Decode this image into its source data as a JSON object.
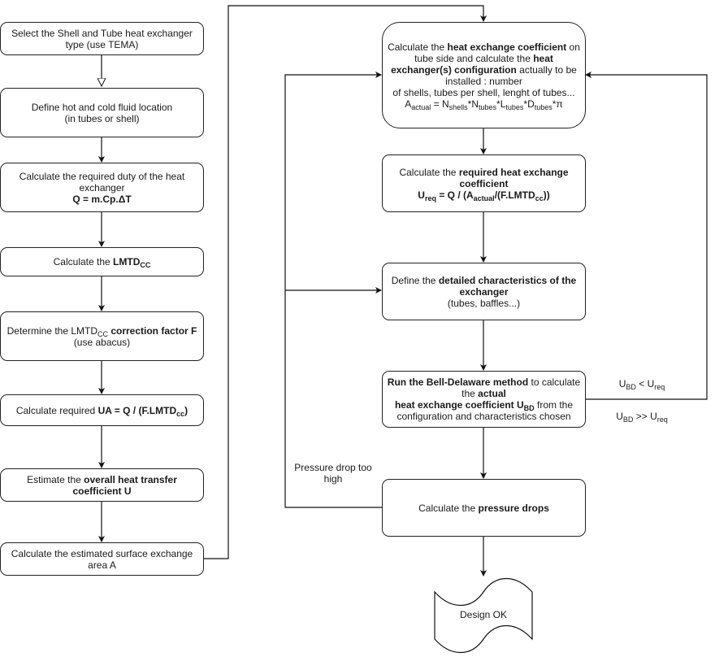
{
  "left_column": [
    {
      "id": "step-select-type",
      "lines": [
        [
          {
            "t": "Select the Shell and Tube heat exchanger type (use TEMA)"
          }
        ]
      ]
    },
    {
      "id": "step-fluid-location",
      "lines": [
        [
          {
            "t": "Define hot and cold fluid location"
          }
        ],
        [
          {
            "t": "(in tubes or shell)"
          }
        ]
      ]
    },
    {
      "id": "step-duty",
      "lines": [
        [
          {
            "t": "Calculate the required duty of the heat exchanger"
          }
        ],
        [
          {
            "t": "Q = m.Cp.ΔT",
            "b": true
          }
        ]
      ]
    },
    {
      "id": "step-lmtd",
      "lines": [
        [
          {
            "t": "Calculate the "
          },
          {
            "t": "LMTD",
            "b": true
          },
          {
            "t": "CC",
            "sub": true,
            "b": true
          }
        ]
      ]
    },
    {
      "id": "step-correction-factor",
      "lines": [
        [
          {
            "t": "Determine the LMTD"
          },
          {
            "t": "CC",
            "sub": true
          },
          {
            "t": " correction factor F",
            "b": true
          }
        ],
        [
          {
            "t": "(use abacus)"
          }
        ]
      ]
    },
    {
      "id": "step-ua",
      "lines": [
        [
          {
            "t": "Calculate required "
          },
          {
            "t": "UA = Q / (F.LMTD",
            "b": true
          },
          {
            "t": "cc",
            "sub": true,
            "b": true
          },
          {
            "t": ")",
            "b": true
          }
        ]
      ]
    },
    {
      "id": "step-estimate-u",
      "lines": [
        [
          {
            "t": "Estimate the "
          },
          {
            "t": "overall heat transfer coefficient U",
            "b": true
          }
        ]
      ]
    },
    {
      "id": "step-surface-area",
      "lines": [
        [
          {
            "t": "Calculate the estimated surface exchange area A"
          }
        ]
      ]
    }
  ],
  "right_column": [
    {
      "id": "step-tube-side",
      "lines": [
        [
          {
            "t": "Calculate the "
          },
          {
            "t": "heat exchange coefficient",
            "b": true
          },
          {
            "t": " on tube side and calculate the "
          },
          {
            "t": "heat exchanger(s) configuration",
            "b": true
          },
          {
            "t": " actually to be installed : number"
          }
        ],
        [
          {
            "t": "of shells, tubes per shell, lenght of tubes..."
          }
        ],
        [
          {
            "t": "A"
          },
          {
            "t": "actual",
            "sub": true
          },
          {
            "t": " = N"
          },
          {
            "t": "shells",
            "sub": true
          },
          {
            "t": "*N"
          },
          {
            "t": "tubes",
            "sub": true
          },
          {
            "t": "*L"
          },
          {
            "t": "tubes",
            "sub": true
          },
          {
            "t": "*D"
          },
          {
            "t": "tubes",
            "sub": true
          },
          {
            "t": "*π"
          }
        ]
      ]
    },
    {
      "id": "step-ureq",
      "lines": [
        [
          {
            "t": "Calculate the "
          },
          {
            "t": "required heat exchange coefficient",
            "b": true
          }
        ],
        [
          {
            "t": "U",
            "b": true
          },
          {
            "t": "req",
            "sub": true,
            "b": true
          },
          {
            "t": " = Q / (A",
            "b": true
          },
          {
            "t": "actual",
            "sub": true,
            "b": true
          },
          {
            "t": "/(F.LMTD",
            "b": true
          },
          {
            "t": "cc",
            "sub": true,
            "b": true
          },
          {
            "t": "))",
            "b": true
          }
        ]
      ]
    },
    {
      "id": "step-detailed-characteristics",
      "lines": [
        [
          {
            "t": "Define the "
          },
          {
            "t": "detailed characteristics of the exchanger",
            "b": true
          }
        ],
        [
          {
            "t": "(tubes, baffles...)"
          }
        ]
      ]
    },
    {
      "id": "step-bell-delaware",
      "lines": [
        [
          {
            "t": "Run the Bell-Delaware method",
            "b": true
          },
          {
            "t": " to calculate the "
          },
          {
            "t": "actual",
            "b": true
          }
        ],
        [
          {
            "t": "heat exchange coefficient U",
            "b": true
          },
          {
            "t": "BD",
            "sub": true,
            "b": true
          },
          {
            "t": " from the configuration and characteristics chosen"
          }
        ]
      ]
    },
    {
      "id": "step-pressure-drops",
      "lines": [
        [
          {
            "t": "Calculate the "
          },
          {
            "t": "pressure drops",
            "b": true
          }
        ]
      ]
    }
  ],
  "labels": {
    "ubd_less": [
      {
        "t": "U"
      },
      {
        "t": "BD",
        "sub": true
      },
      {
        "t": " < U"
      },
      {
        "t": "req",
        "sub": true
      }
    ],
    "ubd_greater": [
      {
        "t": "U"
      },
      {
        "t": "BD",
        "sub": true
      },
      {
        "t": " >> U"
      },
      {
        "t": "req",
        "sub": true
      }
    ],
    "pressure_too_high": "Pressure drop too high"
  },
  "terminal": {
    "label": "Design OK"
  },
  "colors": {
    "stroke": "#222222",
    "background": "#ffffff",
    "text": "#1a1a1a"
  }
}
